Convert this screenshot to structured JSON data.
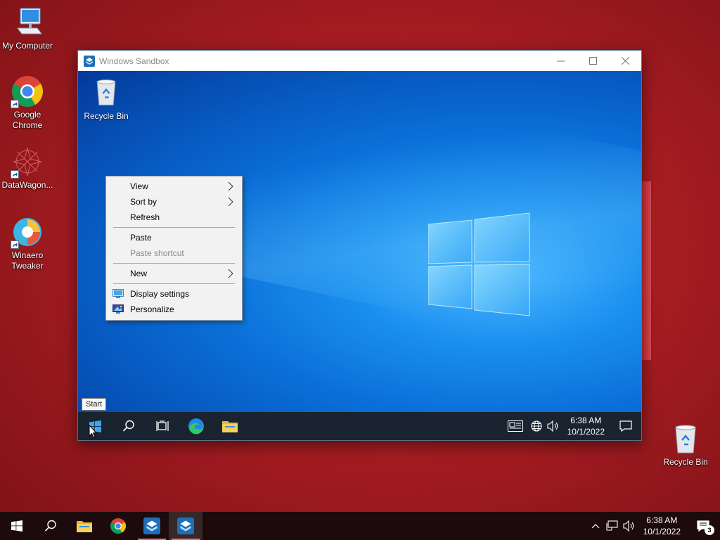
{
  "host": {
    "desktop_icons": [
      {
        "label": "My Computer",
        "icon": "computer-icon"
      },
      {
        "label": "Google Chrome",
        "icon": "chrome-icon"
      },
      {
        "label": "DataWagon...",
        "icon": "datawagon-icon"
      },
      {
        "label": "Winaero Tweaker",
        "icon": "winaero-icon"
      },
      {
        "label": "Recycle Bin",
        "icon": "recycle-bin-icon"
      }
    ],
    "taskbar": {
      "time": "6:38 AM",
      "date": "10/1/2022",
      "notification_count": "3"
    }
  },
  "window": {
    "title": "Windows Sandbox"
  },
  "guest": {
    "desktop_icons": [
      {
        "label": "Recycle Bin",
        "icon": "recycle-bin-icon"
      }
    ],
    "context_menu": {
      "items": [
        {
          "label": "View",
          "submenu": true
        },
        {
          "label": "Sort by",
          "submenu": true
        },
        {
          "label": "Refresh"
        },
        {
          "label": "Paste"
        },
        {
          "label": "Paste shortcut",
          "disabled": true
        },
        {
          "label": "New",
          "submenu": true
        },
        {
          "label": "Display settings",
          "icon": "display-settings-icon"
        },
        {
          "label": "Personalize",
          "icon": "personalize-icon"
        }
      ]
    },
    "tooltip": "Start",
    "taskbar": {
      "time": "6:38 AM",
      "date": "10/1/2022"
    }
  },
  "colors": {
    "host_wallpaper": "#a81d22",
    "guest_wallpaper": "#0a6fd8",
    "taskbar_guest": "#1a2430",
    "taskbar_host": "#1c0a0c",
    "menu_bg": "#f2f2f2"
  }
}
